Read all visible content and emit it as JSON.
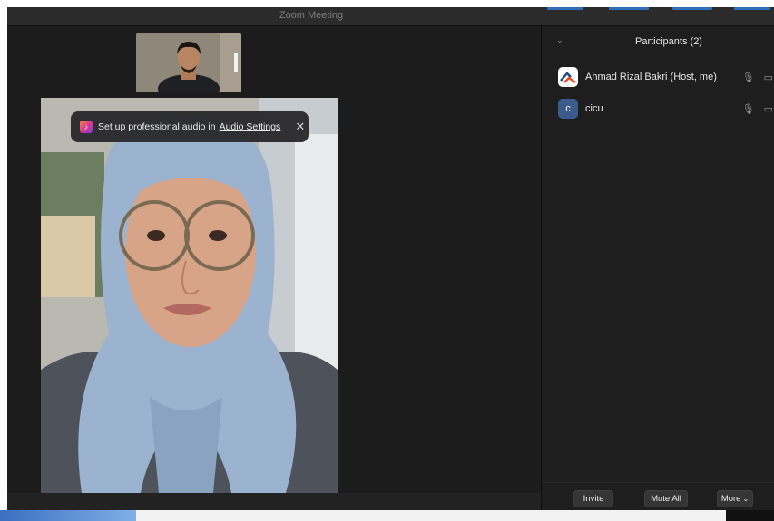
{
  "window": {
    "title": "Zoom Meeting"
  },
  "toast": {
    "message": "Set up professional audio in",
    "link_label": "Audio Settings",
    "close_glyph": "✕",
    "icon": "music-note-icon"
  },
  "participants": {
    "header": "Participants (2)",
    "list": [
      {
        "name": "Ahmad Rizal Bakri (Host, me)",
        "avatar": "logo",
        "mic_icon": "mic-icon",
        "cam_icon": "video-camera-icon"
      },
      {
        "name": "cicu",
        "avatar_letter": "c",
        "avatar_color": "#3d5a8c",
        "mic_icon": "mic-icon",
        "cam_icon": "video-camera-icon"
      }
    ],
    "buttons": {
      "invite": "Invite",
      "mute_all": "Mute All",
      "more": "More"
    }
  },
  "colors": {
    "accent": "#2f6fb6",
    "panel_bg": "#1e1e1e"
  }
}
